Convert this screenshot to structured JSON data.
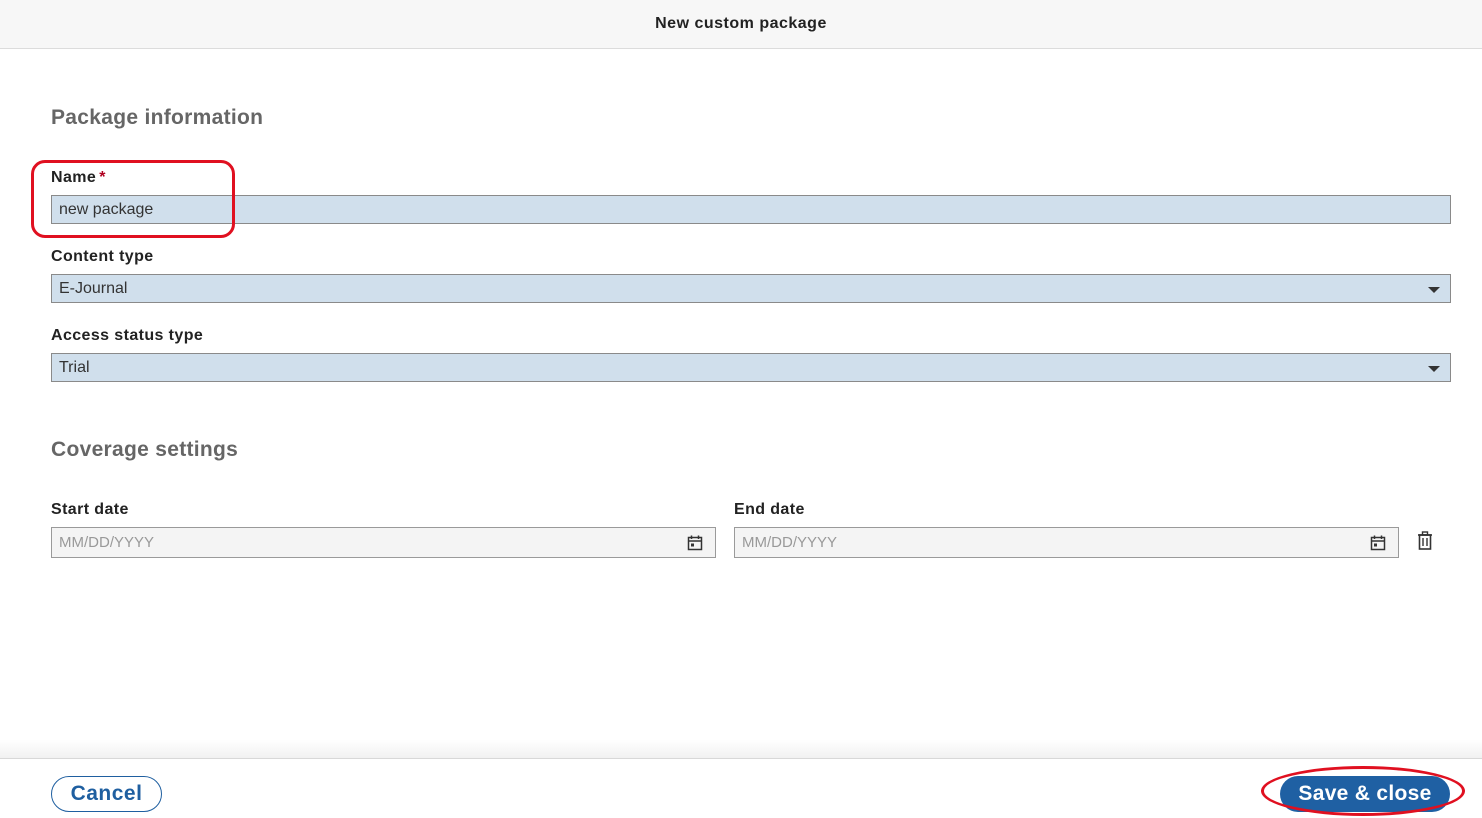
{
  "header": {
    "title": "New custom package"
  },
  "package_info": {
    "section_title": "Package information",
    "name": {
      "label": "Name",
      "required_mark": "*",
      "value": "new package"
    },
    "content_type": {
      "label": "Content type",
      "value": "E-Journal"
    },
    "access_status": {
      "label": "Access status type",
      "value": "Trial"
    }
  },
  "coverage": {
    "section_title": "Coverage settings",
    "start_date": {
      "label": "Start date",
      "placeholder": "MM/DD/YYYY"
    },
    "end_date": {
      "label": "End date",
      "placeholder": "MM/DD/YYYY"
    }
  },
  "footer": {
    "cancel_label": "Cancel",
    "save_label": "Save & close"
  },
  "colors": {
    "primary": "#1f60a3",
    "field_bg": "#d0dfec",
    "annotation": "#e01020",
    "required": "#b00020"
  },
  "icons": {
    "calendar": "calendar-icon",
    "trash": "trash-icon",
    "dropdown": "chevron-down-icon"
  }
}
